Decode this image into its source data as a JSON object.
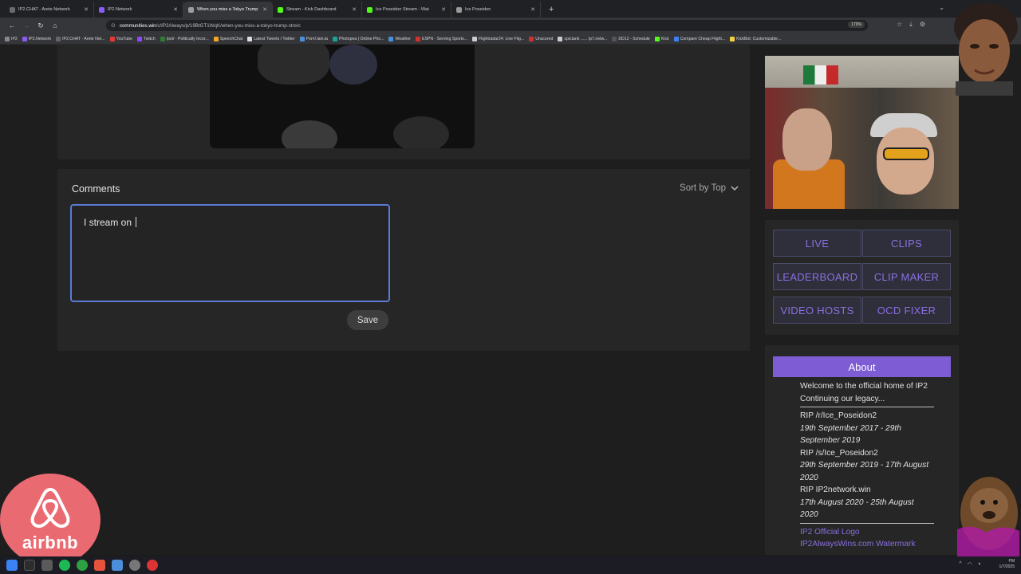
{
  "browser": {
    "tabs": [
      {
        "title": "IP2.CHAT - Arete Network",
        "fav": "#6b6b6b"
      },
      {
        "title": "IP2.Network",
        "fav": "#8b5cf6"
      },
      {
        "title": "When you miss a Tokyo Trump",
        "fav": "#9e9e9e"
      },
      {
        "title": "Stream - Kick Dashboard",
        "fav": "#53fc18"
      },
      {
        "title": "Ice Poseidon Stream - Wat",
        "fav": "#53fc18"
      },
      {
        "title": "Ice Poseidon",
        "fav": "#999999"
      }
    ],
    "url_host": "communities.win",
    "url_path": "/c/IP2Always/p/19BtGT1WqK/when-you-miss-a-tokyo-trump-stre/c",
    "zoom": "170%",
    "bookmarks": [
      {
        "label": "IP2",
        "fav": "#888"
      },
      {
        "label": "IP2.Network",
        "fav": "#8b5cf6"
      },
      {
        "label": "IP2.CHAT - Arete Net...",
        "fav": "#666"
      },
      {
        "label": "YouTube",
        "fav": "#e53935"
      },
      {
        "label": "Twitch",
        "fav": "#9146ff"
      },
      {
        "label": "/pol/ - Politically Incor...",
        "fav": "#2e7d32"
      },
      {
        "label": "SpeechChat",
        "fav": "#f5a623"
      },
      {
        "label": "Latest Tweets / Twitter",
        "fav": "#ddd"
      },
      {
        "label": "Porn!.lain.la",
        "fav": "#4a90d9"
      },
      {
        "label": "Photopea | Online Pho...",
        "fav": "#18a497"
      },
      {
        "label": "Weather",
        "fav": "#4a90d9"
      },
      {
        "label": "ESPN - Serving Sports...",
        "fav": "#d32f2f"
      },
      {
        "label": "Flightradar24: Live Flig...",
        "fav": "#ccc"
      },
      {
        "label": "Unscored",
        "fav": "#d32f2f"
      },
      {
        "label": "spictank ...... ip7.netw...",
        "fav": "#ccc"
      },
      {
        "label": "DD12 - Schedule",
        "fav": "#555"
      },
      {
        "label": "Kick",
        "fav": "#53fc18"
      },
      {
        "label": "Compare Cheap Flight...",
        "fav": "#3b82f6"
      },
      {
        "label": "KickBot: Customizable...",
        "fav": "#f5d142"
      }
    ]
  },
  "comments": {
    "title": "Comments",
    "sort_label": "Sort by Top",
    "editor_text": "I stream on ",
    "save_label": "Save"
  },
  "sidebar": {
    "buttons": [
      "LIVE",
      "CLIPS",
      "LEADERBOARD",
      "CLIP MAKER",
      "VIDEO HOSTS",
      "OCD FIXER"
    ],
    "about": {
      "header": "About",
      "lines": [
        {
          "text": "Welcome to the official home of IP2",
          "style": "normal"
        },
        {
          "text": "Continuing our legacy...",
          "style": "normal"
        },
        {
          "text": "",
          "style": "sep"
        },
        {
          "text": "RIP /r/Ice_Poseidon2",
          "style": "normal"
        },
        {
          "text": "19th September 2017 - 29th September 2019",
          "style": "italic"
        },
        {
          "text": "RIP /s/Ice_Poseidon2",
          "style": "normal"
        },
        {
          "text": "29th September 2019 - 17th August 2020",
          "style": "italic"
        },
        {
          "text": "RIP IP2network.win",
          "style": "normal"
        },
        {
          "text": "17th August 2020 - 25th August 2020",
          "style": "italic"
        },
        {
          "text": "",
          "style": "sep"
        },
        {
          "text": "IP2 Official Logo",
          "style": "link"
        },
        {
          "text": "IP2AlwaysWins.com Watermark",
          "style": "link"
        }
      ]
    }
  },
  "overlay": {
    "airbnb_word": "airbnb"
  },
  "taskbar": {
    "time": "PM",
    "date": "1/7/2025"
  },
  "colors": {
    "accent": "#7d5cd4",
    "accent_text": "#8a6fe0",
    "editor_border": "#5b7bd5",
    "airbnb": "#ea6a72"
  }
}
